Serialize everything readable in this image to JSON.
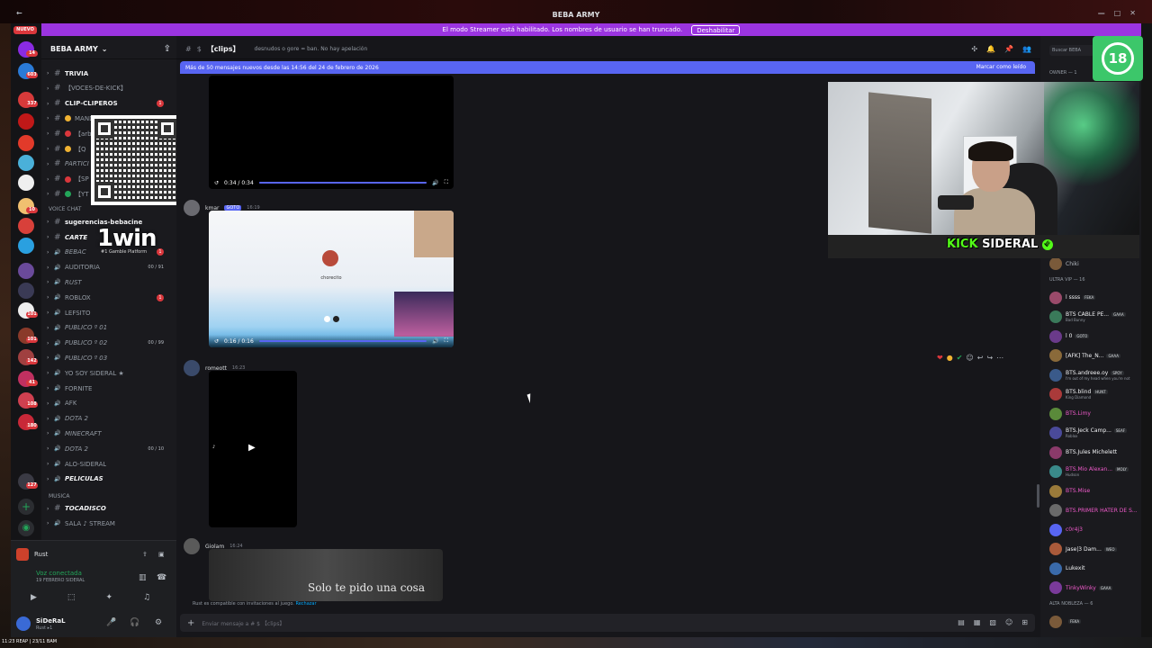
{
  "window": {
    "title": "BEBA ARMY",
    "back_icon": "arrow-left-icon",
    "controls": [
      "minimize",
      "maximize",
      "close"
    ]
  },
  "banner": {
    "text": "El modo Streamer está habilitado. Los nombres de usuario se han truncado.",
    "button": "Deshabilitar"
  },
  "rail": {
    "nuevo": "NUEVO",
    "badges": [
      "14",
      "603",
      "337",
      "10",
      "101",
      "101",
      "142",
      "41",
      "108",
      "180",
      "127"
    ]
  },
  "server": {
    "name": "BEBA ARMY",
    "channels": [
      {
        "label": "TRIVIA",
        "type": "hash",
        "bold": true
      },
      {
        "label": "【VOCES-DE-KICK】",
        "type": "hash"
      },
      {
        "label": "CLIP-CLIPEROS",
        "type": "hash",
        "bold": true,
        "unread": "1"
      },
      {
        "label": "MANDA",
        "type": "hash",
        "dot": "#f0b232"
      },
      {
        "label": "【arb",
        "type": "hash",
        "dot": "#da373c"
      },
      {
        "label": "【Q",
        "type": "hash",
        "dot": "#f0b232"
      },
      {
        "label": "PARTICI",
        "type": "hash",
        "ital": true
      },
      {
        "label": "【SP",
        "type": "hash",
        "dot": "#da373c"
      },
      {
        "label": "【YT",
        "type": "hash",
        "dot": "#23a559"
      }
    ],
    "voice_category": "VOICE CHAT",
    "voice": [
      {
        "label": "sugerencias-bebacine",
        "bold": true
      },
      {
        "label": "CARTE",
        "ital": true,
        "bold": true
      },
      {
        "label": "BEBAC",
        "ital": true,
        "unread": "1"
      },
      {
        "label": "AUDITORIA",
        "counts": "00 / 91"
      },
      {
        "label": "RUST",
        "ital": true
      },
      {
        "label": "ROBLOX",
        "unread": "1"
      },
      {
        "label": "LEFSITO"
      },
      {
        "label": "PUBLICO º 01",
        "ital": true
      },
      {
        "label": "PUBLICO º 02",
        "ital": true,
        "counts": "00 / 99"
      },
      {
        "label": "PUBLICO º 03",
        "ital": true
      },
      {
        "label": "YO SOY SIDERAL ★"
      },
      {
        "label": "FORNITE"
      },
      {
        "label": "AFK"
      },
      {
        "label": "DOTA 2",
        "ital": true
      },
      {
        "label": "MINECRAFT",
        "ital": true
      },
      {
        "label": "DOTA 2",
        "ital": true,
        "counts": "00 / 10"
      },
      {
        "label": "ALO-SIDERAL"
      },
      {
        "label": "PELICULAS",
        "ital": true,
        "bold": true
      }
    ],
    "music_category": "MUSICA",
    "music": [
      {
        "label": "TOCADISCO",
        "ital": true,
        "bold": true
      },
      {
        "label": "SALA ♪ STREAM"
      }
    ]
  },
  "promo": {
    "brand": "1win",
    "sub": "#1 Gamble Platform"
  },
  "voice_panel": {
    "game": "Rust",
    "status": "Voz conectada",
    "channel": "19 FEBRERO SIDERAL",
    "user": "SiDeRaL",
    "user_sub": "Rust ▸1"
  },
  "channel": {
    "name": "【clips】",
    "topic": "desnudos o gore = ban. No hay apelación",
    "search_placeholder": "Buscar BEBA",
    "new_messages": "Más de 50 mensajes nuevos desde las 14:56 del 24 de febrero de 2026",
    "mark_read": "Marcar como leído",
    "owner": "OWNER — 1"
  },
  "messages": [
    {
      "user": "",
      "time": "",
      "video_time": "0:34 / 0:34",
      "progress": 1.0
    },
    {
      "user": "kmar",
      "tag": "GOTO",
      "time": "16:19",
      "video_time": "0:16 / 0:16",
      "progress": 1.0,
      "caption": "chorecito",
      "bottom_caption": ""
    },
    {
      "user": "romeott",
      "time": "16:23"
    },
    {
      "user": "Giolam",
      "time": "16:24",
      "lyric": "Solo te pido una cosa"
    }
  ],
  "composer": {
    "placeholder": "Enviar mensaje a # $ 【clips】",
    "rust_note": "Rust es compatible con invitaciones al juego.",
    "rust_dismiss": "Rechazar"
  },
  "members": [
    {
      "header": "",
      "name": "Chiki",
      "color": "#b5bac1"
    },
    {
      "header": "ULTRA VIP — 16"
    },
    {
      "name": "l ssss",
      "tag": "FEKA",
      "color": "#f2f3f5"
    },
    {
      "name": "BTS CABLE PE...",
      "tag": "GAAA",
      "sub": "Bad Bunny",
      "color": "#f2f3f5"
    },
    {
      "name": "l 0",
      "tag": "GOTO",
      "color": "#f2f3f5"
    },
    {
      "name": "[AFK] The_N...",
      "tag": "GAAA",
      "color": "#f2f3f5"
    },
    {
      "name": "BTS.andreee.oy",
      "tag": "SPOY",
      "sub": "I'm out of my head when you're not",
      "color": "#f2f3f5"
    },
    {
      "name": "BTS.blind",
      "tag": "HUNT",
      "sub": "King Diamond",
      "color": "#f2f3f5"
    },
    {
      "name": "BTS.Limy",
      "color": "#f05acb"
    },
    {
      "name": "BTS.Jeck Camp...",
      "tag": "SEAF",
      "sub": "Roblox",
      "color": "#f2f3f5"
    },
    {
      "name": "BTS.Jules Michelett",
      "color": "#f2f3f5"
    },
    {
      "name": "BTS.Mio Alexan...",
      "tag": "MOLY",
      "sub": "Hudson",
      "color": "#f05acb"
    },
    {
      "name": "BTS.Mise",
      "color": "#f05acb"
    },
    {
      "name": "BTS.PRIMER HATER DE S...",
      "color": "#f05acb"
    },
    {
      "name": "c0r4j3",
      "color": "#f05acb"
    },
    {
      "name": "Jase|3 Dam...",
      "tag": "WEO",
      "color": "#f2f3f5"
    },
    {
      "name": "Lukexit",
      "color": "#f2f3f5"
    },
    {
      "name": "TinkyWinky",
      "tag": "GAAA",
      "color": "#f05acb"
    },
    {
      "header": "ALTA NOBLEZA — 6"
    },
    {
      "name": "",
      "tag": "FEKA",
      "color": "#f2f3f5"
    }
  ],
  "overlay": {
    "kick_brand": "KICK",
    "kick_name": "SIDERAL",
    "age": "18"
  },
  "taskbar": {
    "left_text": "11:23 REAP | 23/11 BAM"
  },
  "icons": {
    "hash": "#",
    "speaker": "🔊",
    "arrow": "▾",
    "play": "▶",
    "mute": "🔇",
    "fullscreen": "⛶",
    "replay": "↺",
    "plus": "+",
    "pin": "📌",
    "bell": "🔔",
    "members": "👥",
    "gear": "⚙",
    "headphones": "🎧",
    "mic": "🎤",
    "gift": "🎁",
    "gif": "GIF",
    "sticker": "☺",
    "emoji": "😊",
    "apps": "⊞"
  },
  "colors": {
    "brand": "#5865f2",
    "streamer": "#9b34e0",
    "danger": "#da373c",
    "kick_green": "#53fc18"
  }
}
